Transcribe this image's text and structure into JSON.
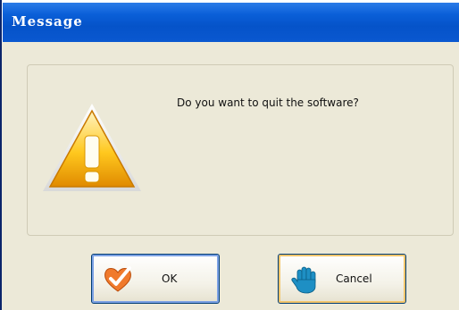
{
  "window": {
    "title": "Message"
  },
  "dialog": {
    "message": "Do you want to quit the software?"
  },
  "buttons": {
    "ok": {
      "label": "OK",
      "icon": "check-heart-icon"
    },
    "cancel": {
      "label": "Cancel",
      "icon": "stop-hand-icon"
    }
  },
  "icons": {
    "warning": "warning-triangle-icon"
  },
  "colors": {
    "titlebar": "#0A5FD8",
    "background": "#ECE9D8",
    "warning": "#F5B800"
  }
}
